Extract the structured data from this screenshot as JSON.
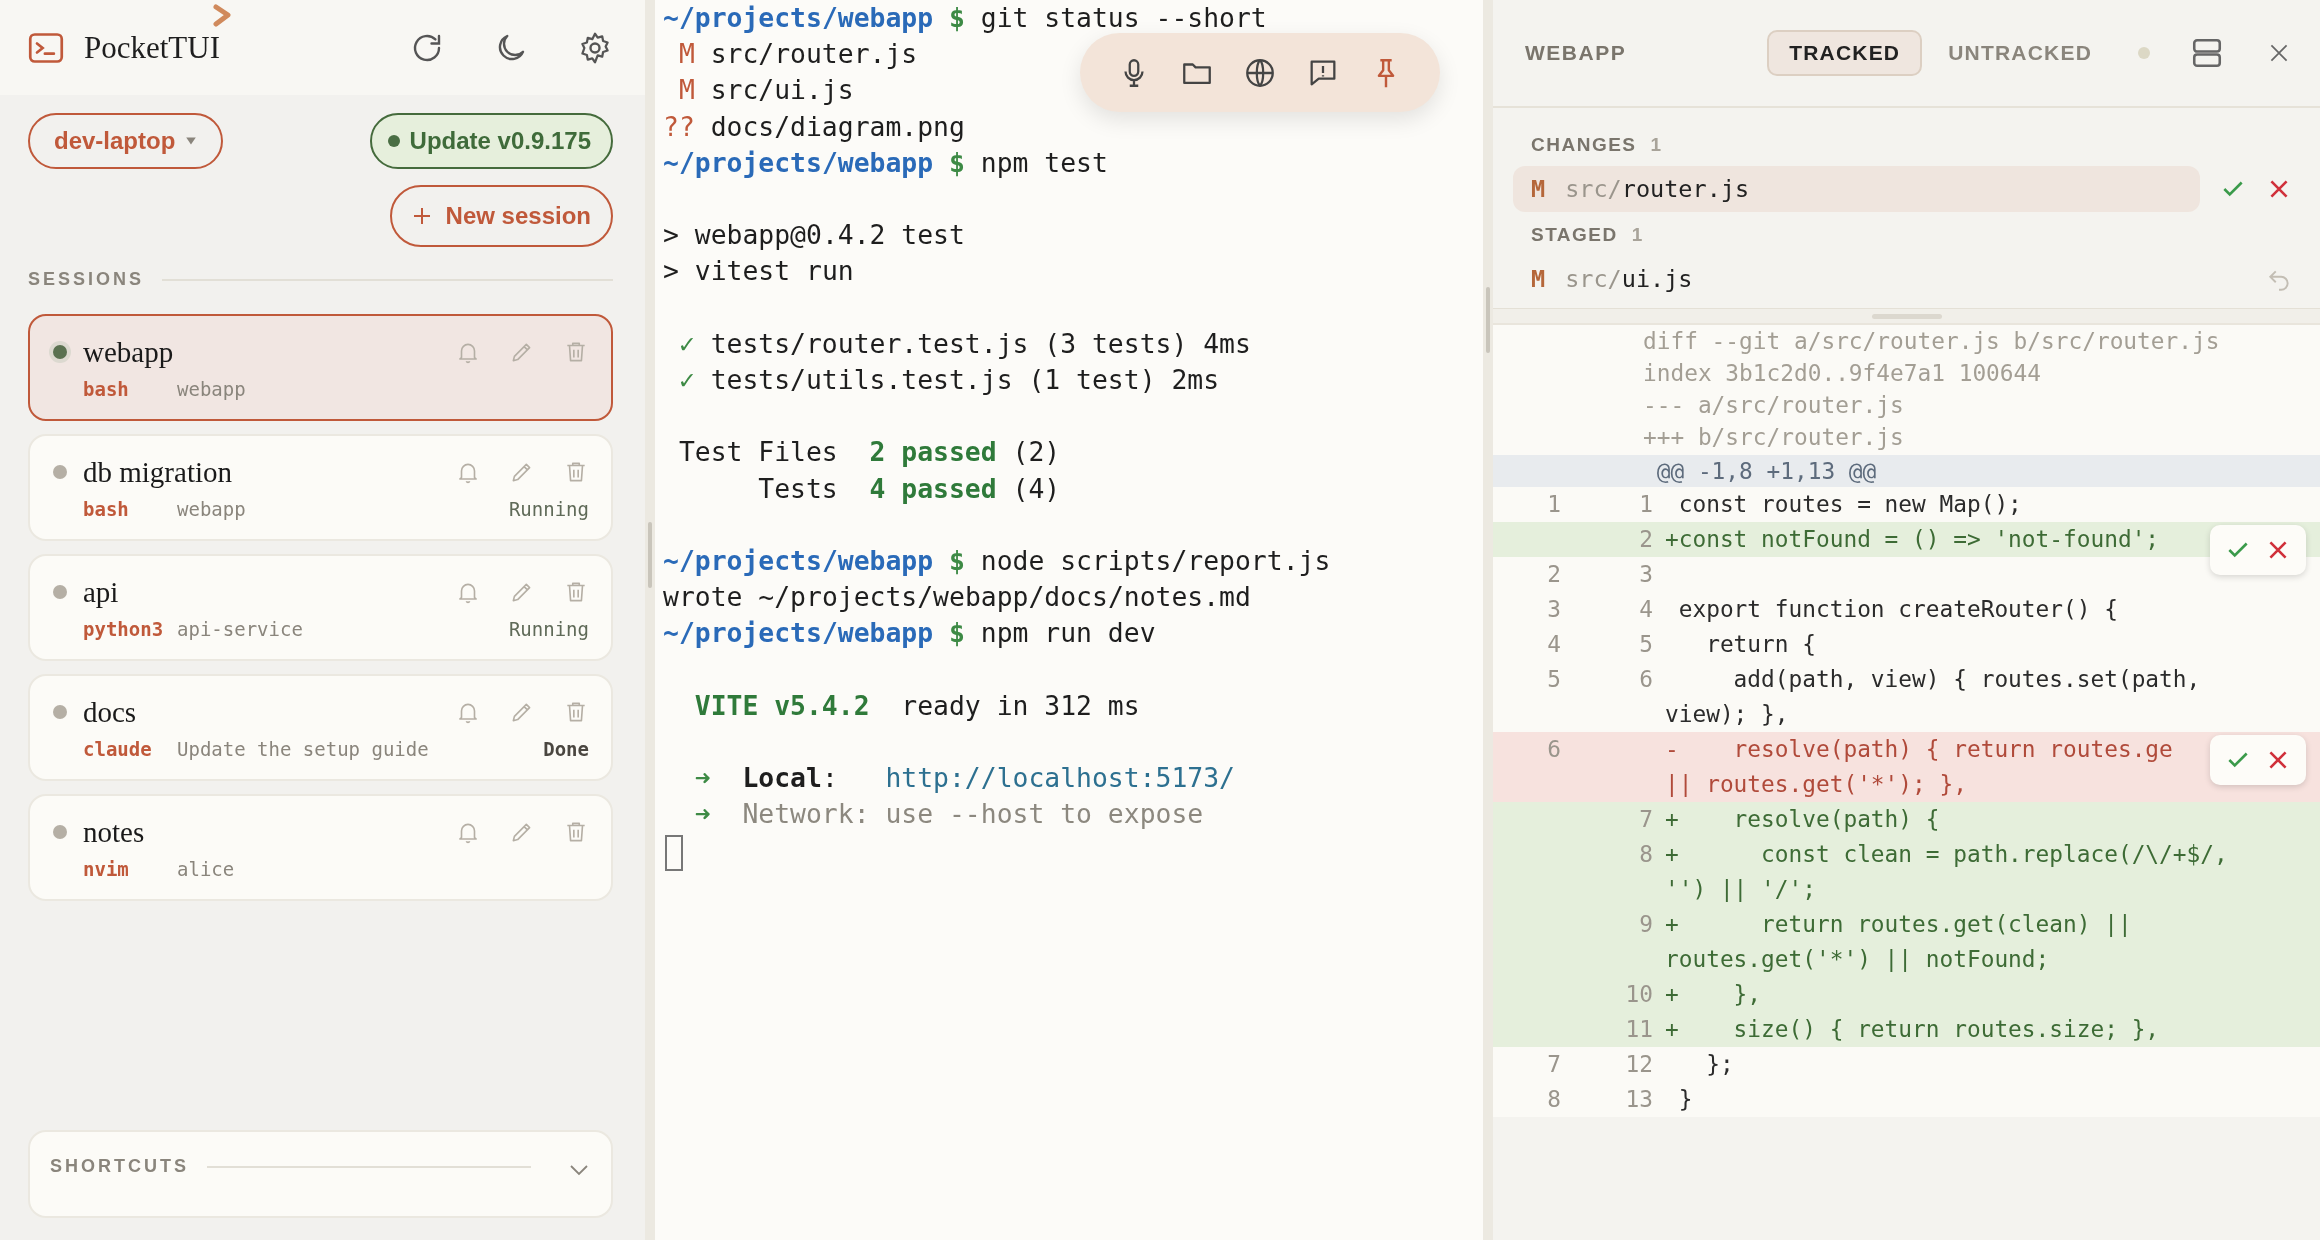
{
  "app": {
    "title": "PocketTUI"
  },
  "host": {
    "label": "dev-laptop"
  },
  "update": {
    "label": "Update v0.9.175"
  },
  "new_session": {
    "label": "New session"
  },
  "sessions_label": "SESSIONS",
  "sessions": [
    {
      "name": "webapp",
      "shell": "bash",
      "detail": "webapp",
      "selected": true
    },
    {
      "name": "db migration",
      "shell": "bash",
      "detail": "webapp",
      "status": {
        "text": "Running",
        "kind": "running"
      },
      "selected": false
    },
    {
      "name": "api",
      "shell": "python3",
      "detail": "api-service",
      "status": {
        "text": "Running",
        "kind": "running"
      },
      "selected": false
    },
    {
      "name": "docs",
      "shell": "claude",
      "detail": "Update the setup guide",
      "status": {
        "text": "Done",
        "kind": "done"
      },
      "selected": false
    },
    {
      "name": "notes",
      "shell": "nvim",
      "detail": "alice",
      "selected": false
    }
  ],
  "shortcuts": {
    "label": "SHORTCUTS",
    "expanded": false
  },
  "terminal": {
    "cursor": true,
    "lines": [
      {
        "kind": "prompt",
        "path": "~/projects/webapp",
        "symbol": "$",
        "command": "git status --short"
      },
      {
        "kind": "status",
        "code": "M",
        "file": "src/router.js"
      },
      {
        "kind": "status",
        "code": "M",
        "file": "src/ui.js"
      },
      {
        "kind": "status",
        "code": "??",
        "file": "docs/diagram.png"
      },
      {
        "kind": "prompt",
        "path": "~/projects/webapp",
        "symbol": "$",
        "command": "npm test"
      },
      {
        "kind": "blank"
      },
      {
        "kind": "plain",
        "text": "> webapp@0.4.2 test"
      },
      {
        "kind": "plain",
        "text": "> vitest run"
      },
      {
        "kind": "blank"
      },
      {
        "kind": "test",
        "mark": "✓",
        "text": "tests/router.test.js (3 tests) 4ms"
      },
      {
        "kind": "test",
        "mark": "✓",
        "text": "tests/utils.test.js (1 test) 2ms"
      },
      {
        "kind": "blank"
      },
      {
        "kind": "summary",
        "label": "Test Files",
        "result": "2 passed",
        "total": "(2)"
      },
      {
        "kind": "summary",
        "label": "Tests",
        "result": "4 passed",
        "total": "(4)"
      },
      {
        "kind": "blank"
      },
      {
        "kind": "prompt",
        "path": "~/projects/webapp",
        "symbol": "$",
        "command": "node scripts/report.js"
      },
      {
        "kind": "plain",
        "text": "wrote ~/projects/webapp/docs/notes.md"
      },
      {
        "kind": "prompt",
        "path": "~/projects/webapp",
        "symbol": "$",
        "command": "npm run dev"
      },
      {
        "kind": "blank"
      },
      {
        "kind": "banner",
        "name": "VITE v5.4.2",
        "text": "ready in 312 ms"
      },
      {
        "kind": "blank"
      },
      {
        "kind": "link",
        "arrow": "➜",
        "label": "**Local**:",
        "url": "http://localhost:5173/"
      },
      {
        "kind": "note",
        "arrow": "➜",
        "text": "Network: use --host to expose"
      }
    ]
  },
  "git_panel": {
    "repo": "WEBAPP",
    "tabs": [
      {
        "label": "TRACKED",
        "selected": true
      },
      {
        "label": "UNTRACKED",
        "selected": false
      }
    ],
    "sections": [
      {
        "label": "CHANGES",
        "count": "1",
        "kind": "changes",
        "files": [
          {
            "status": "M",
            "dir": "src/",
            "name": "router.js",
            "selected": true
          }
        ]
      },
      {
        "label": "STAGED",
        "count": "1",
        "kind": "staged",
        "files": [
          {
            "status": "M",
            "dir": "src/",
            "name": "ui.js",
            "selected": false
          }
        ]
      }
    ]
  },
  "diff": {
    "meta": [
      "diff --git a/src/router.js b/src/router.js",
      "index 3b1c2d0..9f4e7a1 100644",
      "--- a/src/router.js",
      "+++ b/src/router.js"
    ],
    "hunk": " @@ -1,8 +1,13 @@",
    "rows": [
      {
        "old": "1",
        "new": "1",
        "kind": "context",
        "text": " const routes = new Map();"
      },
      {
        "new": "2",
        "kind": "add",
        "text": "+const notFound = () => 'not-found';",
        "actions": true
      },
      {
        "old": "2",
        "new": "3",
        "kind": "context"
      },
      {
        "old": "3",
        "new": "4",
        "kind": "context",
        "text": " export function createRouter() {"
      },
      {
        "old": "4",
        "new": "5",
        "kind": "context",
        "text": "   return {"
      },
      {
        "old": "5",
        "new": "6",
        "kind": "context",
        "text": "     add(path, view) { routes.set(path,\nview); },"
      },
      {
        "old": "6",
        "kind": "del",
        "text": "-    resolve(path) { return routes.ge\n|| routes.get('*'); },",
        "actions": true
      },
      {
        "new": "7",
        "kind": "add",
        "text": "+    resolve(path) {"
      },
      {
        "new": "8",
        "kind": "add",
        "text": "+      const clean = path.replace(/\\/+$/,\n'') || '/';"
      },
      {
        "new": "9",
        "kind": "add",
        "text": "+      return routes.get(clean) ||\nroutes.get('*') || notFound;"
      },
      {
        "new": "10",
        "kind": "add",
        "text": "+    },"
      },
      {
        "new": "11",
        "kind": "add",
        "text": "+    size() { return routes.size; },"
      },
      {
        "old": "7",
        "new": "12",
        "kind": "context",
        "text": "   };"
      },
      {
        "old": "8",
        "new": "13",
        "kind": "context",
        "text": " }"
      }
    ]
  }
}
